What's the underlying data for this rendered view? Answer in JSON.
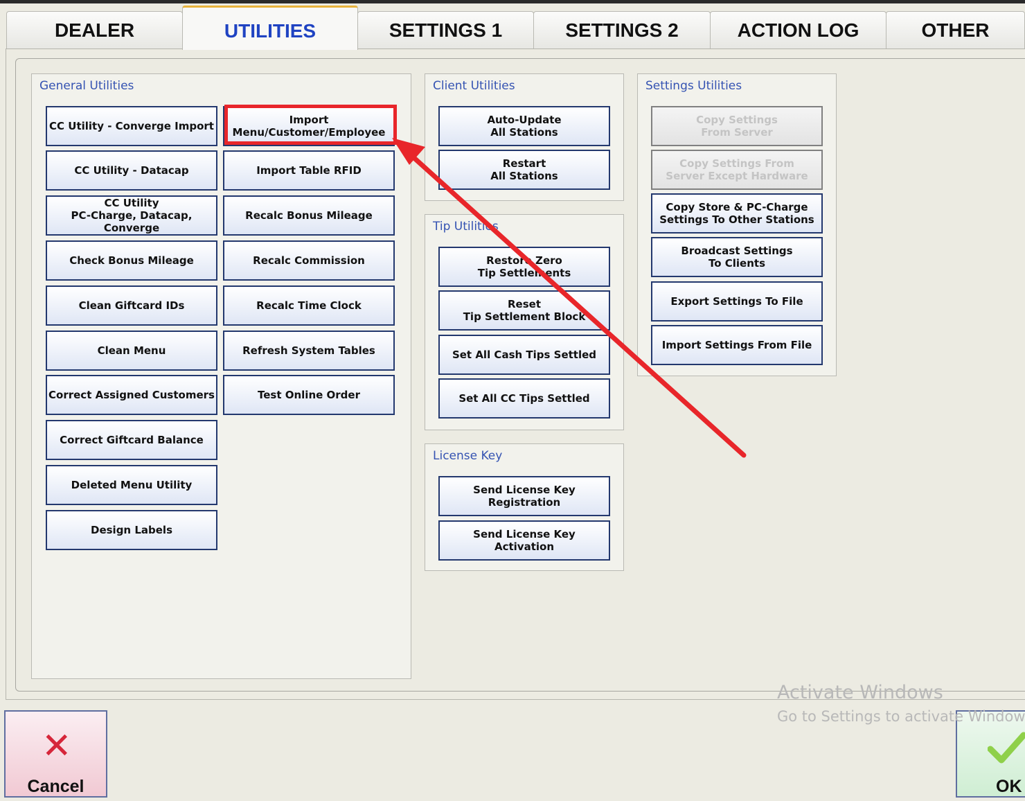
{
  "tabs": [
    {
      "label": "DEALER"
    },
    {
      "label": "UTILITIES"
    },
    {
      "label": "SETTINGS 1"
    },
    {
      "label": "SETTINGS 2"
    },
    {
      "label": "ACTION LOG"
    },
    {
      "label": "OTHER"
    }
  ],
  "general": {
    "title": "General Utilities",
    "buttons": [
      "CC Utility - Converge Import",
      "CC Utility - Datacap",
      "CC Utility\nPC-Charge, Datacap, Converge",
      "Check Bonus Mileage",
      "Clean Giftcard IDs",
      "Clean Menu",
      "Correct Assigned Customers",
      "Correct Giftcard Balance",
      "Deleted Menu Utility",
      "Design Labels",
      "Import\nMenu/Customer/Employee",
      "Import Table RFID",
      "Recalc Bonus Mileage",
      "Recalc Commission",
      "Recalc Time Clock",
      "Refresh System Tables",
      "Test Online Order"
    ]
  },
  "client": {
    "title": "Client Utilities",
    "buttons": [
      "Auto-Update\nAll Stations",
      "Restart\nAll Stations"
    ]
  },
  "tip": {
    "title": "Tip Utilities",
    "buttons": [
      "Restore Zero\nTip Settlements",
      "Reset\nTip Settlement Block",
      "Set All Cash Tips Settled",
      "Set All CC Tips Settled"
    ]
  },
  "license": {
    "title": "License Key",
    "buttons": [
      "Send License Key\nRegistration",
      "Send License Key\nActivation"
    ]
  },
  "settings": {
    "title": "Settings Utilities",
    "buttons": [
      "Copy Settings\nFrom Server",
      "Copy Settings From\nServer Except Hardware",
      "Copy Store & PC-Charge\nSettings To Other Stations",
      "Broadcast Settings\nTo Clients",
      "Export Settings To File",
      "Import Settings From File"
    ]
  },
  "watermark": {
    "line1": "Activate Windows",
    "line2": "Go to Settings to activate Windows."
  },
  "footer": {
    "cancel_label": "Cancel",
    "ok_label": "OK"
  },
  "colors": {
    "accent_blue": "#3553b2",
    "highlight_red": "#e8262a"
  }
}
